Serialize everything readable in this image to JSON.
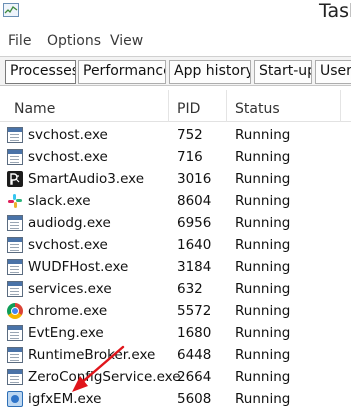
{
  "window": {
    "title": "Task"
  },
  "menu": [
    {
      "label": "File"
    },
    {
      "label": "Options"
    },
    {
      "label": "View"
    }
  ],
  "tabs": [
    {
      "label": "Processes",
      "active": true
    },
    {
      "label": "Performance"
    },
    {
      "label": "App history"
    },
    {
      "label": "Start-up"
    },
    {
      "label": "Users"
    }
  ],
  "columns": {
    "name": "Name",
    "pid": "PID",
    "status": "Status"
  },
  "processes": [
    {
      "name": "svchost.exe",
      "pid": "752",
      "status": "Running",
      "icon": "window-app-icon"
    },
    {
      "name": "svchost.exe",
      "pid": "716",
      "status": "Running",
      "icon": "window-app-icon"
    },
    {
      "name": "SmartAudio3.exe",
      "pid": "3016",
      "status": "Running",
      "icon": "audio-app-icon"
    },
    {
      "name": "slack.exe",
      "pid": "8604",
      "status": "Running",
      "icon": "slack-icon"
    },
    {
      "name": "audiodg.exe",
      "pid": "6956",
      "status": "Running",
      "icon": "window-app-icon"
    },
    {
      "name": "svchost.exe",
      "pid": "1640",
      "status": "Running",
      "icon": "window-app-icon"
    },
    {
      "name": "WUDFHost.exe",
      "pid": "3184",
      "status": "Running",
      "icon": "window-app-icon"
    },
    {
      "name": "services.exe",
      "pid": "632",
      "status": "Running",
      "icon": "window-app-icon"
    },
    {
      "name": "chrome.exe",
      "pid": "5572",
      "status": "Running",
      "icon": "chrome-icon"
    },
    {
      "name": "EvtEng.exe",
      "pid": "1680",
      "status": "Running",
      "icon": "window-app-icon"
    },
    {
      "name": "RuntimeBroker.exe",
      "pid": "6448",
      "status": "Running",
      "icon": "window-app-icon"
    },
    {
      "name": "ZeroConfigService.exe",
      "pid": "2664",
      "status": "Running",
      "icon": "window-app-icon"
    },
    {
      "name": "igfxEM.exe",
      "pid": "5608",
      "status": "Running",
      "icon": "intel-graphics-icon"
    }
  ],
  "colors": {
    "annotation_arrow": "#e0151b",
    "tab_bar": "#f3f3f3",
    "accent": "#4a73a8"
  }
}
